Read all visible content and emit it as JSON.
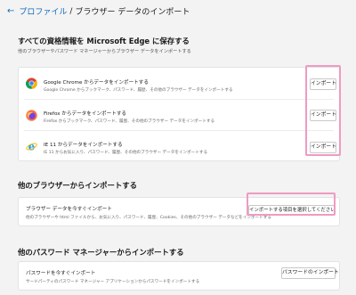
{
  "breadcrumb": {
    "back_arrow": "←",
    "parent": "プロファイル",
    "separator": "/",
    "current": "ブラウザー データのインポート"
  },
  "section1": {
    "title": "すべての資格情報を Microsoft Edge に保存する",
    "subtitle": "他のブラウザーやパスワード マネージャーからブラウザー データをインポートする",
    "rows": [
      {
        "icon": "chrome-icon",
        "title": "Google Chrome からデータをインポートする",
        "desc": "Google Chrome からブックマーク、パスワード、履歴、その他のブラウザー データをインポートする",
        "button": "インポート"
      },
      {
        "icon": "firefox-icon",
        "title": "Firefox からデータをインポートする",
        "desc": "Firefox からブックマーク、パスワード、履歴、その他のブラウザー データをインポートする",
        "button": "インポート"
      },
      {
        "icon": "ie-icon",
        "title": "IE 11 からデータをインポートする",
        "desc": "IE 11 からお気に入り、パスワード、履歴、その他のブラウザー データをインポートする",
        "button": "インポート"
      }
    ]
  },
  "section2": {
    "title": "他のブラウザーからインポートする",
    "row": {
      "title": "ブラウザー データを今すぐインポート",
      "desc": "他のブラウザーや html ファイルから、お気に入り、パスワード、履歴、Cookies、その他のブラウザー データなどをインポートする",
      "button": "インポートする項目を選択してください"
    }
  },
  "section3": {
    "title": "他のパスワード マネージャーからインポートする",
    "row": {
      "title": "パスワードを今すぐインポート",
      "desc": "サードパーティのパスワード マネージャー アプリケーションからパスワードをインポートする",
      "button": "パスワードのインポート"
    }
  },
  "colors": {
    "accent": "#0f6cbd",
    "highlight": "#ef9bc2",
    "background": "#f3f3f3"
  }
}
